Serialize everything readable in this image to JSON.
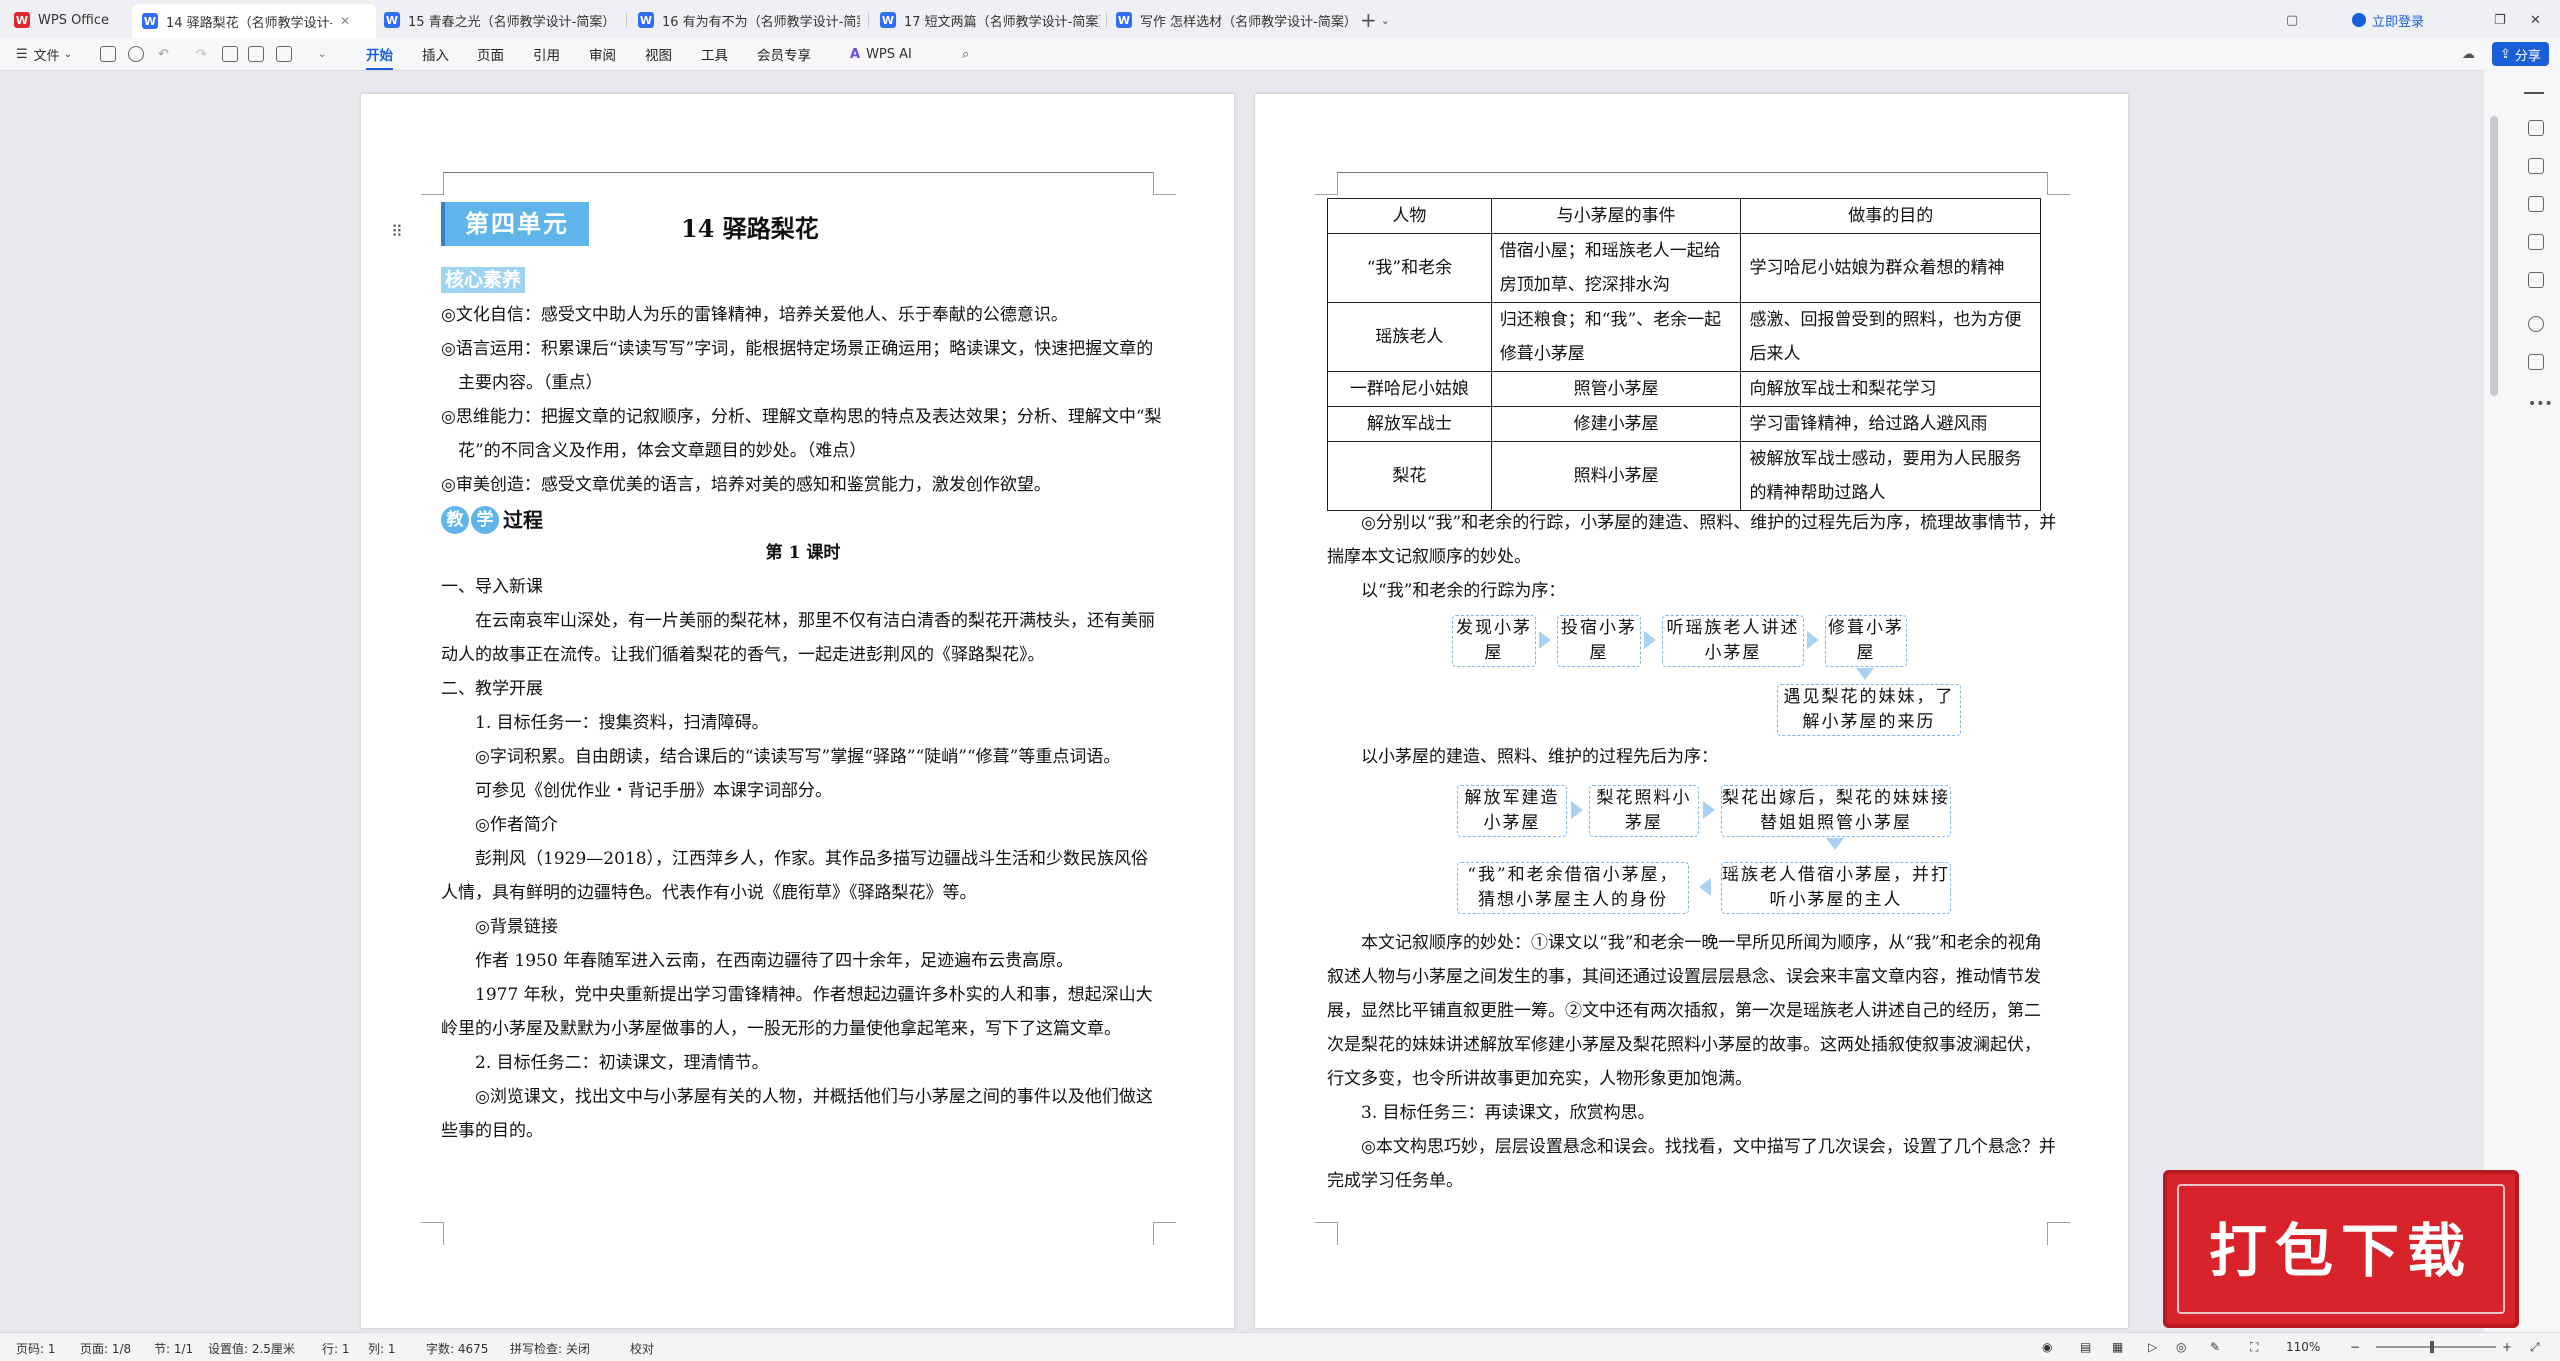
{
  "tabs": [
    {
      "label": "WPS Office"
    },
    {
      "label": "14 驿路梨花（名师教学设计-"
    },
    {
      "label": "15 青春之光（名师教学设计-简案）"
    },
    {
      "label": "16 有为有不为（名师教学设计-简案）"
    },
    {
      "label": "17 短文两篇（名师教学设计-简案）"
    },
    {
      "label": "写作 怎样选材（名师教学设计-简案）"
    }
  ],
  "window": {
    "login": "立即登录",
    "share": "分享"
  },
  "ribbon": {
    "file": "文件",
    "tabs": [
      "开始",
      "插入",
      "页面",
      "引用",
      "审阅",
      "视图",
      "工具",
      "会员专享"
    ],
    "ai": "WPS AI"
  },
  "left": {
    "unit": "第四单元",
    "title": "14  驿路梨花",
    "core_label": "核心素养",
    "core": [
      "◎文化自信：感受文中助人为乐的雷锋精神，培养关爱他人、乐于奉献的公德意识。",
      "◎语言运用：积累课后“读读写写”字词，能根据特定场景正确运用；略读课文，快速把握文章的主要内容。（重点）",
      "◎思维能力：把握文章的记叙顺序，分析、理解文章构思的特点及表达效果；分析、理解文中“梨花”的不同含义及作用，体会文章题目的妙处。（难点）",
      "◎审美创造：感受文章优美的语言，培养对美的感知和鉴赏能力，激发创作欲望。"
    ],
    "process_a": "教",
    "process_b": "学",
    "process_c": "过程",
    "lesson": "第 1 课时",
    "sec1": "一、导入新课",
    "para1": "在云南哀牢山深处，有一片美丽的梨花林，那里不仅有洁白清香的梨花开满枝头，还有美丽动人的故事正在流传。让我们循着梨花的香气，一起走进彭荆风的《驿路梨花》。",
    "sec2": "二、教学开展",
    "task1": "1. 目标任务一：搜集资料，扫清障碍。",
    "words": "◎字词积累。自由朗读，结合课后的“读读写写”掌握“驿路”“陡峭”“修葺”等重点词语。",
    "ref": "可参见《创优作业・背记手册》本课字词部分。",
    "author_h": "◎作者简介",
    "author": "彭荆风（1929—2018），江西萍乡人，作家。其作品多描写边疆战斗生活和少数民族风俗人情，具有鲜明的边疆特色。代表作有小说《鹿衔草》《驿路梨花》等。",
    "bg_h": "◎背景链接",
    "bg1": "作者 1950 年春随军进入云南，在西南边疆待了四十余年，足迹遍布云贵高原。",
    "bg2": "1977 年秋，党中央重新提出学习雷锋精神。作者想起边疆许多朴实的人和事，想起深山大岭里的小茅屋及默默为小茅屋做事的人，一股无形的力量使他拿起笔来，写下了这篇文章。",
    "task2": "2. 目标任务二：初读课文，理清情节。",
    "browse": "◎浏览课文，找出文中与小茅屋有关的人物，并概括他们与小茅屋之间的事件以及他们做这些事的目的。"
  },
  "right": {
    "table": {
      "headers": [
        "人物",
        "与小茅屋的事件",
        "做事的目的"
      ],
      "rows": [
        [
          "“我”和老余",
          "借宿小屋；和瑶族老人一起给房顶加草、挖深排水沟",
          "学习哈尼小姑娘为群众着想的精神"
        ],
        [
          "瑶族老人",
          "归还粮食；和“我”、老余一起修葺小茅屋",
          "感激、回报曾受到的照料，也为方便后来人"
        ],
        [
          "一群哈尼小姑娘",
          "照管小茅屋",
          "向解放军战士和梨花学习"
        ],
        [
          "解放军战士",
          "修建小茅屋",
          "学习雷锋精神，给过路人避风雨"
        ],
        [
          "梨花",
          "照料小茅屋",
          "被解放军战士感动，要用为人民服务的精神帮助过路人"
        ]
      ]
    },
    "order_intro": "◎分别以“我”和老余的行踪，小茅屋的建造、照料、维护的过程先后为序，梳理故事情节，并揣摩本文记叙顺序的妙处。",
    "flow1_title": "以“我”和老余的行踪为序：",
    "flow1": [
      "发现小茅屋",
      "投宿小茅屋",
      "听瑶族老人讲述小茅屋",
      "修葺小茅屋",
      "遇见梨花的妹妹，了解小茅屋的来历"
    ],
    "flow2_title": "以小茅屋的建造、照料、维护的过程先后为序：",
    "flow2": [
      "解放军建造小茅屋",
      "梨花照料小茅屋",
      "梨花出嫁后，梨花的妹妹接替姐姐照管小茅屋",
      "瑶族老人借宿小茅屋，并打听小茅屋的主人",
      "“我”和老余借宿小茅屋，猜想小茅屋主人的身份"
    ],
    "analysis": "本文记叙顺序的妙处：①课文以“我”和老余一晚一早所见所闻为顺序，从“我”和老余的视角叙述人物与小茅屋之间发生的事，其间还通过设置层层悬念、误会来丰富文章内容，推动情节发展，显然比平铺直叙更胜一筹。②文中还有两次插叙，第一次是瑶族老人讲述自己的经历，第二次是梨花的妹妹讲述解放军修建小茅屋及梨花照料小茅屋的故事。这两处插叙使叙事波澜起伏，行文多变，也令所讲故事更加充实，人物形象更加饱满。",
    "task3": "3. 目标任务三：再读课文，欣赏构思。",
    "suspense": "◎本文构思巧妙，层层设置悬念和误会。找找看，文中描写了几次误会，设置了几个悬念？并完成学习任务单。"
  },
  "banner": {
    "text": "打包下载",
    "color": "#d8232a"
  },
  "status": {
    "page_no": "页码: 1",
    "pages": "页面: 1/8",
    "section": "节: 1/1",
    "setting": "设置值: 2.5厘米",
    "row": "行: 1",
    "col": "列: 1",
    "words": "字数: 4675",
    "spell": "拼写检查: 关闭",
    "proof": "校对",
    "zoom": "110%"
  }
}
